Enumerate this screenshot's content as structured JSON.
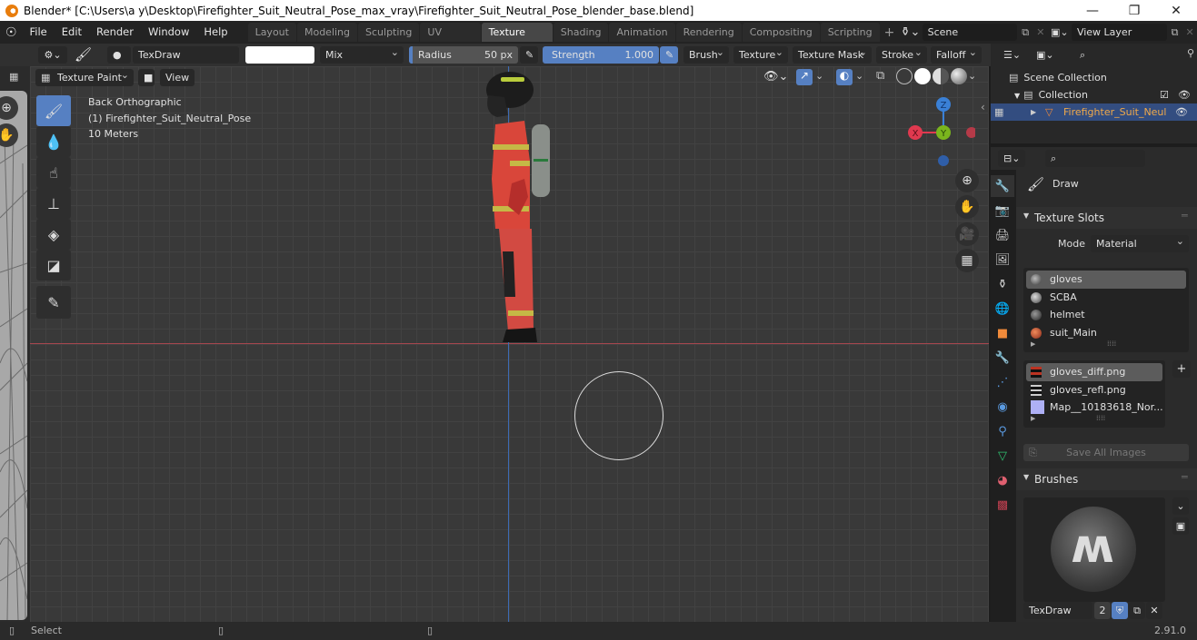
{
  "window": {
    "title": "Blender* [C:\\Users\\a y\\Desktop\\Firefighter_Suit_Neutral_Pose_max_vray\\Firefighter_Suit_Neutral_Pose_blender_base.blend]",
    "controls": {
      "minimize": "—",
      "maximize": "❐",
      "close": "✕"
    }
  },
  "menubar": {
    "items": [
      "File",
      "Edit",
      "Render",
      "Window",
      "Help"
    ]
  },
  "workspaces": {
    "tabs": [
      "Layout",
      "Modeling",
      "Sculpting",
      "UV Editing",
      "Texture Paint",
      "Shading",
      "Animation",
      "Rendering",
      "Compositing",
      "Scripting"
    ],
    "active": "Texture Paint",
    "add_label": "+"
  },
  "scene": {
    "name": "Scene",
    "view_layer": "View Layer"
  },
  "tool_header": {
    "brush_name": "TexDraw",
    "color_hex": "#ffffff",
    "blend_mode": "Mix",
    "radius_label": "Radius",
    "radius_value": "50 px",
    "strength_label": "Strength",
    "strength_value": "1.000",
    "strength_fraction": 1.0,
    "menus": [
      "Brush",
      "Texture",
      "Texture Mask",
      "Stroke",
      "Falloff"
    ]
  },
  "viewport_header": {
    "mode": "Texture Paint",
    "view_label": "View"
  },
  "viewport": {
    "overlay_lines": [
      "Back Orthographic",
      "(1) Firefighter_Suit_Neutral_Pose",
      "10 Meters"
    ],
    "gizmo": {
      "x": "X",
      "y": "Y",
      "z": "Z"
    },
    "colors": {
      "x_axis": "#e0394f",
      "y_axis": "#7ab51d",
      "z_axis": "#3a80d6",
      "brush_circle": "#dcdcdc"
    }
  },
  "tools": [
    "draw-brush",
    "soften-brush",
    "smear-brush",
    "clone-brush",
    "fill-brush",
    "mask-brush",
    "annotate"
  ],
  "outliner": {
    "items": [
      {
        "label": "Scene Collection",
        "level": 0
      },
      {
        "label": "Collection",
        "level": 1,
        "checked": true
      },
      {
        "label": "Firefighter_Suit_Neul",
        "level": 2,
        "selected": true
      }
    ]
  },
  "properties": {
    "brush_header": "Draw",
    "texture_slots": {
      "title": "Texture Slots",
      "mode_label": "Mode",
      "mode_value": "Material",
      "materials": [
        "gloves",
        "SCBA",
        "helmet",
        "suit_Main"
      ],
      "selected_material": "gloves",
      "images": [
        "gloves_diff.png",
        "gloves_refl.png",
        "Map__10183618_Nor..."
      ],
      "selected_image": "gloves_diff.png",
      "add_label": "+",
      "save_all_label": "Save All Images"
    },
    "brushes": {
      "title": "Brushes",
      "brush_name": "TexDraw",
      "users": "2"
    }
  },
  "statusbar": {
    "left_action": "Select",
    "version": "2.91.0"
  }
}
